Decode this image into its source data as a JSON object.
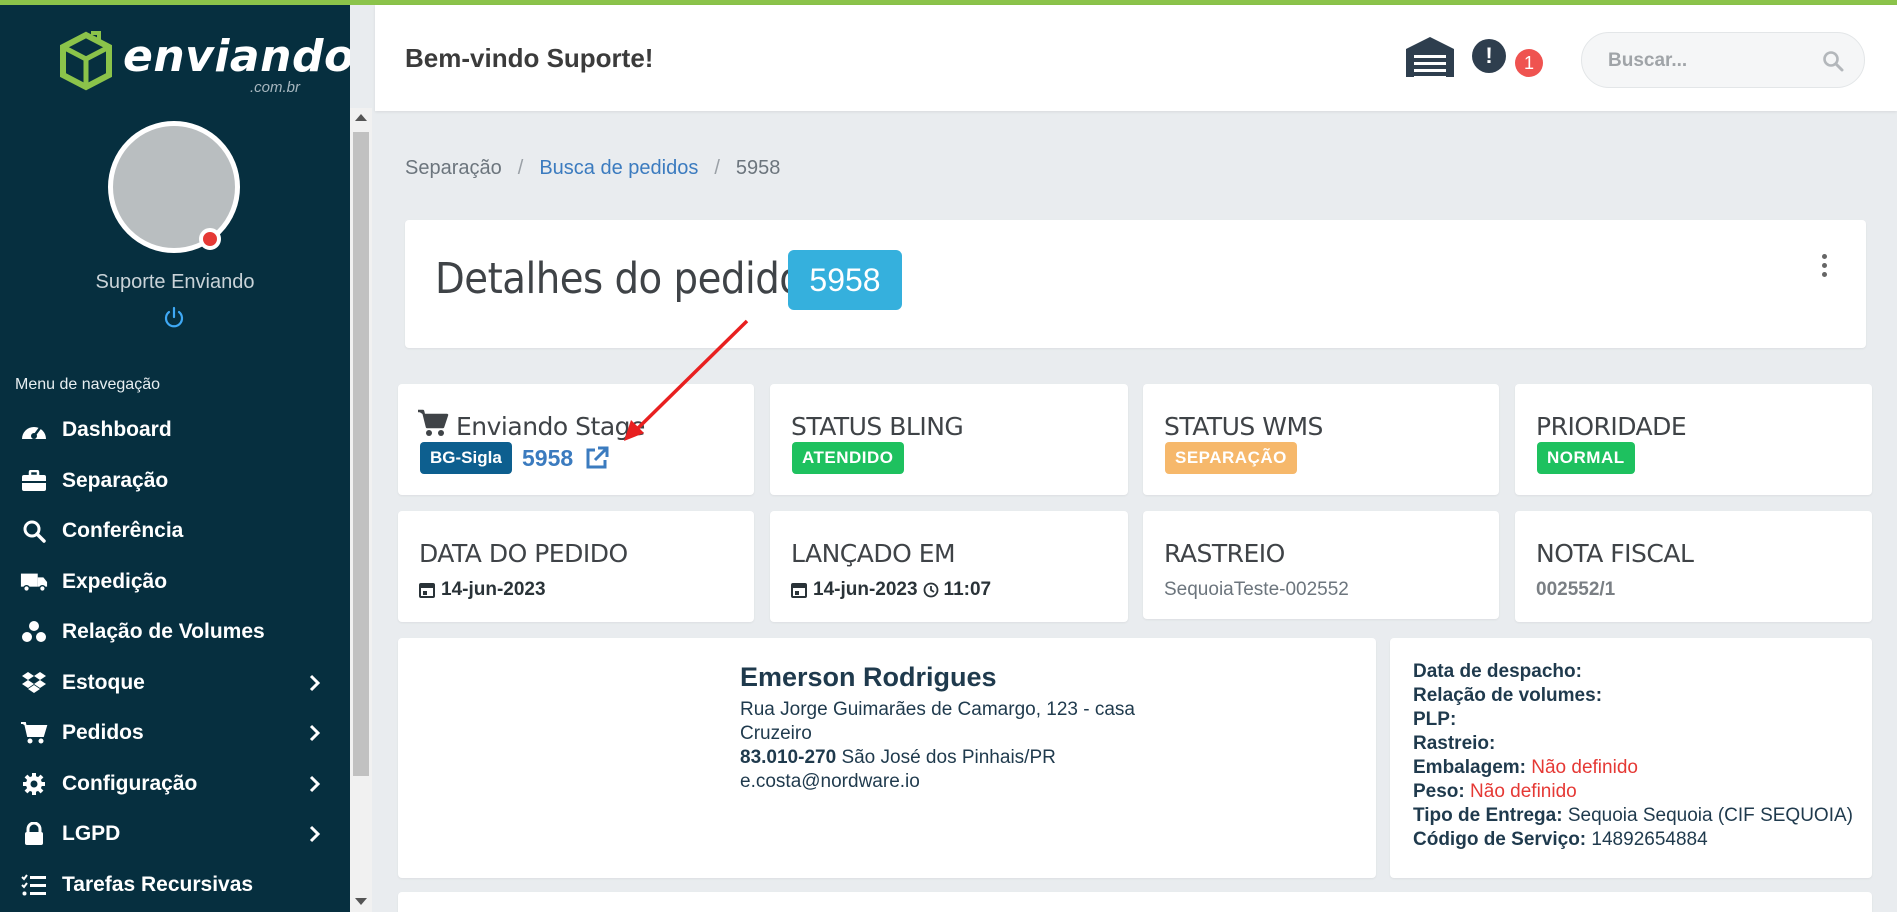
{
  "brand": {
    "name": "enviando",
    "sub": ".com.br",
    "color": "#8bc34a"
  },
  "user": {
    "name": "Suporte Enviando"
  },
  "nav": {
    "title": "Menu de navegação",
    "items": [
      {
        "label": "Dashboard",
        "icon": "gauge-icon",
        "has_children": false
      },
      {
        "label": "Separação",
        "icon": "briefcase-icon",
        "has_children": false
      },
      {
        "label": "Conferência",
        "icon": "search-icon",
        "has_children": false
      },
      {
        "label": "Expedição",
        "icon": "truck-icon",
        "has_children": false
      },
      {
        "label": "Relação de Volumes",
        "icon": "boxes-icon",
        "has_children": false
      },
      {
        "label": "Estoque",
        "icon": "dropbox-icon",
        "has_children": true
      },
      {
        "label": "Pedidos",
        "icon": "cart-icon",
        "has_children": true
      },
      {
        "label": "Configuração",
        "icon": "gear-icon",
        "has_children": true
      },
      {
        "label": "LGPD",
        "icon": "lock-icon",
        "has_children": true
      },
      {
        "label": "Tarefas Recursivas",
        "icon": "list-check-icon",
        "has_children": false
      }
    ]
  },
  "header": {
    "welcome": "Bem-vindo Suporte!",
    "notifications_count": "1",
    "alert_symbol": "!",
    "search_placeholder": "Buscar..."
  },
  "breadcrumb": {
    "items": [
      "Separação",
      "Busca de pedidos",
      "5958"
    ]
  },
  "order": {
    "title": "Detalhes do pedido",
    "number": "5958",
    "store_label": "Enviando Stage",
    "store_sigla": "BG-Sigla",
    "store_order_link": "5958",
    "status_bling": {
      "label": "STATUS BLING",
      "value": "ATENDIDO",
      "color": "#1ec15f"
    },
    "status_wms": {
      "label": "STATUS WMS",
      "value": "SEPARAÇÃO",
      "color": "#f6b86b"
    },
    "prioridade": {
      "label": "PRIORIDADE",
      "value": "NORMAL",
      "color": "#1ec15f"
    },
    "data_pedido": {
      "label": "DATA DO PEDIDO",
      "value": "14-jun-2023"
    },
    "lancado_em": {
      "label": "LANÇADO EM",
      "date": "14-jun-2023",
      "time": "11:07"
    },
    "rastreio": {
      "label": "RASTREIO",
      "value": "SequoiaTeste-002552"
    },
    "nota_fiscal": {
      "label": "NOTA FISCAL",
      "value": "002552/1"
    }
  },
  "customer": {
    "name": "Emerson Rodrigues",
    "street": "Rua Jorge Guimarães de Camargo, 123 - casa",
    "district": "Cruzeiro",
    "zip": "83.010-270",
    "city": "São José dos Pinhais/PR",
    "email": "e.costa@nordware.io"
  },
  "shipping": {
    "despacho_label": "Data de despacho:",
    "volumes_label": "Relação de volumes:",
    "plp_label": "PLP:",
    "rastreio_label": "Rastreio:",
    "embalagem_label": "Embalagem:",
    "embalagem_value": "Não definido",
    "peso_label": "Peso:",
    "peso_value": "Não definido",
    "tipo_label": "Tipo de Entrega:",
    "tipo_value": "Sequoia Sequoia (CIF SEQUOIA)",
    "codigo_label": "Código de Serviço:",
    "codigo_value": "14892654884"
  }
}
